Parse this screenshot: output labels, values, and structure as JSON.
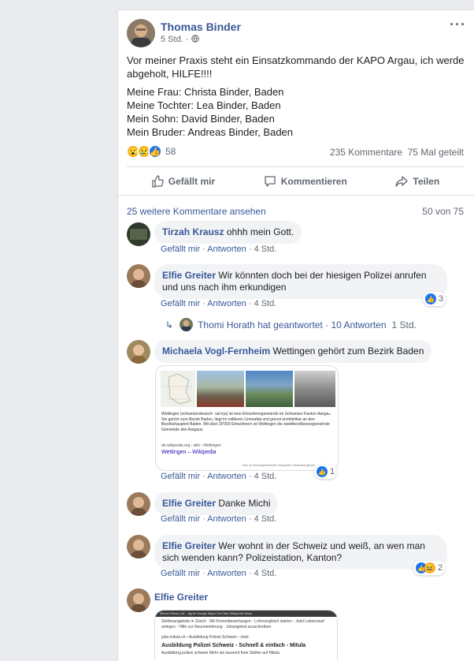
{
  "post": {
    "author": "Thomas Binder",
    "time": "5 Std. ·",
    "menu": "···",
    "paragraph1": "Vor meiner Praxis steht ein Einsatzkommando der KAPO Argau, ich werde abgeholt, HILFE!!!!",
    "lines": [
      "Meine Frau: Christa Binder, Baden",
      "Meine Tochter: Lea Binder, Baden",
      "Mein Sohn: David Binder, Baden",
      "Mein Bruder: Andreas Binder, Baden"
    ],
    "reaction_count": "58",
    "comments_count": "235 Kommentare",
    "shares_count": "75 Mal geteilt",
    "actions": {
      "like": "Gefällt mir",
      "comment": "Kommentieren",
      "share": "Teilen"
    }
  },
  "comments_header": {
    "more": "25 weitere Kommentare ansehen",
    "count": "50 von 75"
  },
  "link_like": "Gefällt mir",
  "link_reply": "Antworten",
  "link_age": "· 4 Std.",
  "comments": [
    {
      "name": "Tirzah Krausz",
      "text": "ohhh mein Gott."
    },
    {
      "name": "Elfie Greiter",
      "text": "Wir könnten doch bei der hiesigen Polizei anrufen und uns nach ihm erkundigen",
      "reactions": "3"
    },
    {
      "name": "Michaela Vogl-Fernheim",
      "text": "Wettingen gehört zum Bezirk Baden",
      "reactions": "1"
    },
    {
      "name": "Elfie Greiter",
      "text": "Danke Michi"
    },
    {
      "name": "Elfie Greiter",
      "text": "Wer wohnt in der Schweiz und weiß, an wen man sich wenden kann? Polizeistation, Kanton?",
      "reactions": "2"
    },
    {
      "name": "Elfie Greiter",
      "text": ""
    }
  ],
  "reply": {
    "text": "Thomi Horath hat geantwortet · 10 Antworten",
    "age": "1 Std."
  },
  "wiki": {
    "text": "Wettingen (schweizerdeutsch ˈʋɛtːiŋə) ist eine Einwohnergemeinde im Schweizer Kanton Aargau. Sie gehört zum Bezirk Baden, liegt im mittleren Limmattal und grenzt unmittelbar an den Bezirkshauptort Baden. Mit über 20'000 Einwohnern ist Wettingen die zweitbevölkerungsreichste Gemeinde des Aargaus.",
    "source": "de.wikipedia.org › wiki › Wettingen",
    "link": "Wettingen – Wikipedia",
    "footer": "Info zu hervorgehobenen Snippets   Feedback geben"
  },
  "screenshot": {
    "bar": "Meiner Meran | M...   Apple   Google Maps   YouTube   Wikipedia   News",
    "line1": "Stellenangebote in Zürich · Mit Firmenbewertungen · Lohnvergleich starten · Jetzt Lebenslauf anlegen · Hilfe zur Neuorientierung · Jobangebot ausschreiben",
    "url": "jobs.mitula.ch › Ausbildung Polizei Schweiz › Jetzt",
    "title": "Ausbildung Polizei Schweiz - Schnell & einfach - Mitula",
    "snippet": "Ausbildung polizei schweiz Mehr als tausend freie Stellen auf Mitula"
  }
}
